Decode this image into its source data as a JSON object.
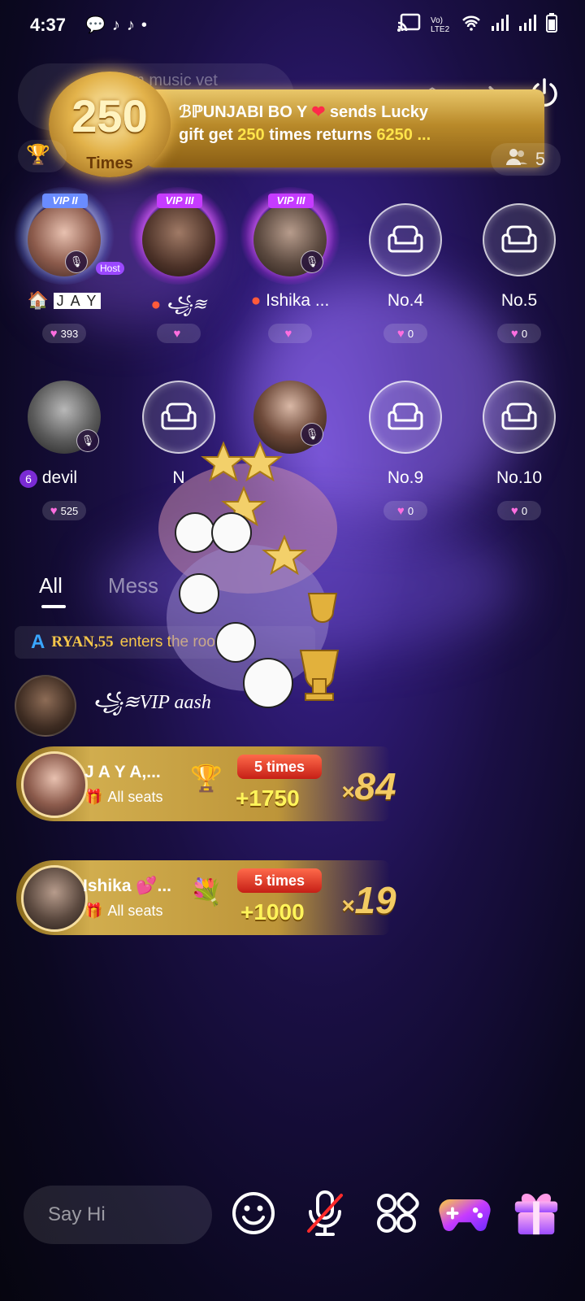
{
  "status_bar": {
    "time": "4:37",
    "left_icons": [
      "chat-bubble-icon",
      "tiktok-icon",
      "tiktok-icon",
      "dot-icon"
    ],
    "right_icons": [
      "cast-icon",
      "volte-icon",
      "wifi-icon",
      "signal-icon",
      "signal-icon",
      "battery-icon"
    ],
    "volte_label": "Vo) LTE2"
  },
  "room": {
    "title_partial": "om music vet"
  },
  "banner": {
    "times_number": "250",
    "times_label": "Times",
    "sender": "ℬℙUNJABI BO Y",
    "line1_suffix": " sends Lucky",
    "line2_prefix": "gift get ",
    "multiplier": "250",
    "line2_middle": " times returns ",
    "returns": "6250 ..."
  },
  "online_count": "5",
  "seats_row1": [
    {
      "name": "J A Y",
      "hearts": "393",
      "vip": "VIP II",
      "host": "Host",
      "level_icon": "home-badge-icon"
    },
    {
      "name": "꧁≋",
      "hearts": "",
      "vip": "VIP III"
    },
    {
      "name": "Ishika ...",
      "hearts": "",
      "vip": "VIP III"
    },
    {
      "name": "No.4",
      "hearts": "0"
    },
    {
      "name": "No.5",
      "hearts": "0"
    }
  ],
  "seats_row2": [
    {
      "name": "devil",
      "hearts": "525",
      "level": "6"
    },
    {
      "name": "N",
      "hearts": ""
    },
    {
      "name": "",
      "hearts": ""
    },
    {
      "name": "No.9",
      "hearts": "0"
    },
    {
      "name": "No.10",
      "hearts": "0"
    }
  ],
  "tabs": {
    "all": "All",
    "messages": "Mess"
  },
  "enter_notice": {
    "name": "RYAN,55",
    "text": "enters the room"
  },
  "message": {
    "name": "꧁≋VIP aash"
  },
  "gift_bars": [
    {
      "name": "J A Y A,...",
      "target": "All seats",
      "times": "5 times",
      "amount": "+1750",
      "combo": "84"
    },
    {
      "name": "Ishika 💕...",
      "target": "All seats",
      "times": "5 times",
      "amount": "+1000",
      "combo": "19"
    }
  ],
  "bottom_bar": {
    "input_placeholder": "Say Hi"
  },
  "colors": {
    "gold": "#d1ad4e",
    "highlight_yellow": "#ffe44a",
    "heart_pink": "#ff6ee0",
    "vip_purple": "#c63bff",
    "vip_silver": "#6a8cff"
  }
}
